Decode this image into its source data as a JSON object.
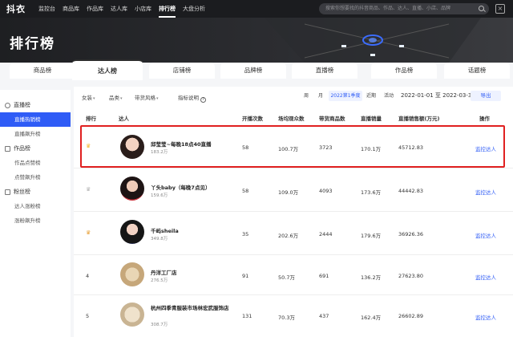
{
  "app": {
    "logo": "抖衣",
    "nav": [
      "监控台",
      "商品库",
      "作品库",
      "达人库",
      "小店库",
      "排行榜",
      "大盘分析"
    ],
    "nav_active_index": 5,
    "search_placeholder": "搜索你想要找的抖音商品、作品、达人、直播、小店、品牌",
    "close_label": "×"
  },
  "hero": {
    "title": "排行榜"
  },
  "tabs": [
    "商品榜",
    "达人榜",
    "店铺榜",
    "品牌榜",
    "直播榜",
    "作品榜",
    "话题榜"
  ],
  "active_tab_index": 1,
  "sidebar": {
    "groups": [
      {
        "label": "直播榜",
        "items": [
          "直播热销榜",
          "直播飙升榜"
        ]
      },
      {
        "label": "作品榜",
        "items": [
          "作品点赞榜",
          "点赞飙升榜"
        ]
      },
      {
        "label": "粉丝榜",
        "items": [
          "达人涨粉榜",
          "涨粉飙升榜"
        ]
      }
    ],
    "active_item": "直播热销榜"
  },
  "filters": {
    "category1": "女装",
    "category2": "品类",
    "style": "带货风格",
    "metric_help": "指标说明",
    "periods": [
      "周",
      "月",
      "2022第1季度",
      "近期",
      "活动"
    ],
    "active_period": "2022第1季度",
    "date_range": "2022-01-01 至 2022-03-31",
    "export_label": "导出"
  },
  "table": {
    "headers": [
      "排行",
      "达人",
      "开播次数",
      "场均观众数",
      "带货商品数",
      "直播销量",
      "直播销售额(万元)",
      "操作"
    ],
    "rows": [
      {
        "rank": "",
        "medal": "gold",
        "name": "邱莹莹~每晚18点40直播",
        "fans": "183.2万",
        "streams": "58",
        "avg_viewers": "100.7万",
        "products": "3723",
        "sales": "170.1万",
        "revenue": "45712.83",
        "action": "监控达人"
      },
      {
        "rank": "",
        "medal": "silver",
        "name": "丫头baby（每晚7点见）",
        "fans": "159.6万",
        "streams": "58",
        "avg_viewers": "109.0万",
        "products": "4093",
        "sales": "173.6万",
        "revenue": "44442.83",
        "action": "监控达人"
      },
      {
        "rank": "",
        "medal": "bronze",
        "name": "千屿sheila",
        "fans": "349.8万",
        "streams": "35",
        "avg_viewers": "202.6万",
        "products": "2444",
        "sales": "179.6万",
        "revenue": "36926.36",
        "action": "监控达人"
      },
      {
        "rank": "4",
        "medal": "",
        "name": "丹洋工厂店",
        "fans": "276.5万",
        "streams": "91",
        "avg_viewers": "50.7万",
        "products": "691",
        "sales": "136.2万",
        "revenue": "27623.80",
        "action": "监控达人"
      },
      {
        "rank": "5",
        "medal": "",
        "name": "杭州四季青服装市场林宏武服饰店",
        "fans": "308.7万",
        "streams": "131",
        "avg_viewers": "70.3万",
        "products": "437",
        "sales": "162.4万",
        "revenue": "26602.89",
        "action": "监控达人"
      }
    ]
  },
  "colors": {
    "accent": "#2f5cf6",
    "highlight": "#e02020",
    "gold": "#f5b82e",
    "silver": "#b5b5b5",
    "bronze": "#e8a23a"
  }
}
